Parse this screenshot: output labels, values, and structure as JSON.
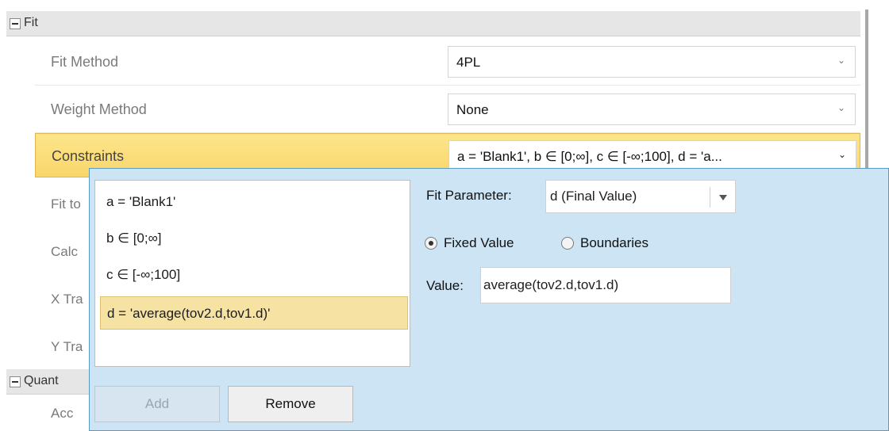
{
  "grid": {
    "categories": [
      {
        "label": "Fit"
      },
      {
        "label": "Quant"
      }
    ],
    "rows": [
      {
        "name": "Fit Method",
        "value": "4PL"
      },
      {
        "name": "Weight Method",
        "value": "None"
      },
      {
        "name": "Constraints",
        "value": "a = 'Blank1', b ∈ [0;∞], c ∈ [-∞;100], d = 'a..."
      }
    ],
    "partial_rows": [
      "Fit to",
      "Calc",
      "X Tra",
      "Y Tra",
      "Acc"
    ]
  },
  "popup": {
    "list_items": [
      "a = 'Blank1'",
      "b ∈ [0;∞]",
      "c ∈ [-∞;100]",
      "d = 'average(tov2.d,tov1.d)'"
    ],
    "add_label": "Add",
    "remove_label": "Remove",
    "fit_parameter_label": "Fit Parameter:",
    "fit_parameter_value": "d (Final Value)",
    "fixed_value_label": "Fixed Value",
    "boundaries_label": "Boundaries",
    "value_label": "Value:",
    "value_text": "average(tov2.d,tov1.d)",
    "mode": "Fixed Value"
  },
  "icons": {
    "collapse": "collapse-icon",
    "dropdown": "chevron-down-icon"
  },
  "colors": {
    "selected_row": "#f9d66b",
    "popup_background": "#cce4f3",
    "popup_border": "#5a9ac6",
    "selected_list_item": "#f6e3a3"
  }
}
